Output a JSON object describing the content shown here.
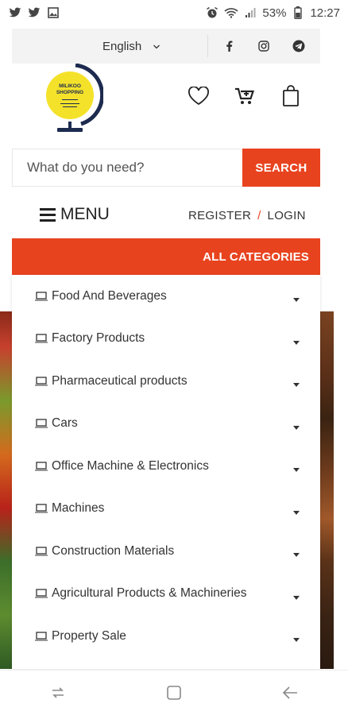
{
  "statusbar": {
    "battery": "53%",
    "time": "12:27",
    "left_icons": [
      "twitter-icon",
      "twitter-icon",
      "image-icon"
    ],
    "right_icons": [
      "alarm-icon",
      "wifi-icon",
      "signal-icon",
      "battery-icon"
    ]
  },
  "topbar": {
    "language": "English",
    "social": [
      "facebook-icon",
      "instagram-icon",
      "telegram-icon"
    ]
  },
  "logo": {
    "line1": "MILIKOO",
    "line2": "SHOPPING"
  },
  "header_icons": [
    "heart-icon",
    "cart-add-icon",
    "bag-icon"
  ],
  "search": {
    "placeholder": "What do you need?",
    "button": "SEARCH"
  },
  "menu": {
    "label": "MENU",
    "register": "REGISTER",
    "separator": "/",
    "login": "LOGIN"
  },
  "categories": {
    "header": "ALL CATEGORIES",
    "items": [
      "Food And Beverages",
      "Factory Products",
      "Pharmaceutical products",
      "Cars",
      "Office Machine & Electronics",
      "Machines",
      "Construction Materials",
      "Agricultural Products & Machineries",
      "Property Sale"
    ]
  },
  "colors": {
    "accent": "#e8431f",
    "logo_yellow": "#f4e22a",
    "logo_navy": "#1d2b4f"
  }
}
